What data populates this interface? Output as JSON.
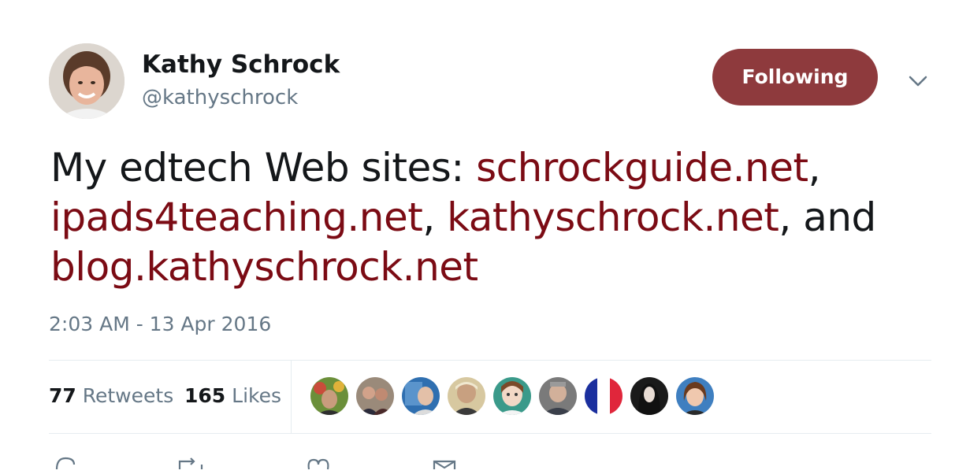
{
  "author": {
    "name": "Kathy Schrock",
    "handle": "@kathyschrock"
  },
  "follow_button": {
    "label": "Following"
  },
  "tweet": {
    "text_prefix": "My edtech Web sites: ",
    "links": [
      "schrockguide.net",
      "ipads4teaching.net",
      "kathyschrock.net",
      "blog.kathyschrock.net"
    ],
    "sep_1": ",",
    "sep_2": ", ",
    "sep_3": ", and",
    "timestamp": "2:03 AM - 13 Apr 2016"
  },
  "stats": {
    "retweets_count": "77",
    "retweets_label": "Retweets",
    "likes_count": "165",
    "likes_label": "Likes"
  },
  "colors": {
    "link": "#7b0b14",
    "follow_button": "#8e3a3d",
    "muted_text": "#657786"
  },
  "icons": [
    "chevron-down-icon",
    "reply-icon",
    "retweet-icon",
    "like-icon",
    "message-icon"
  ]
}
